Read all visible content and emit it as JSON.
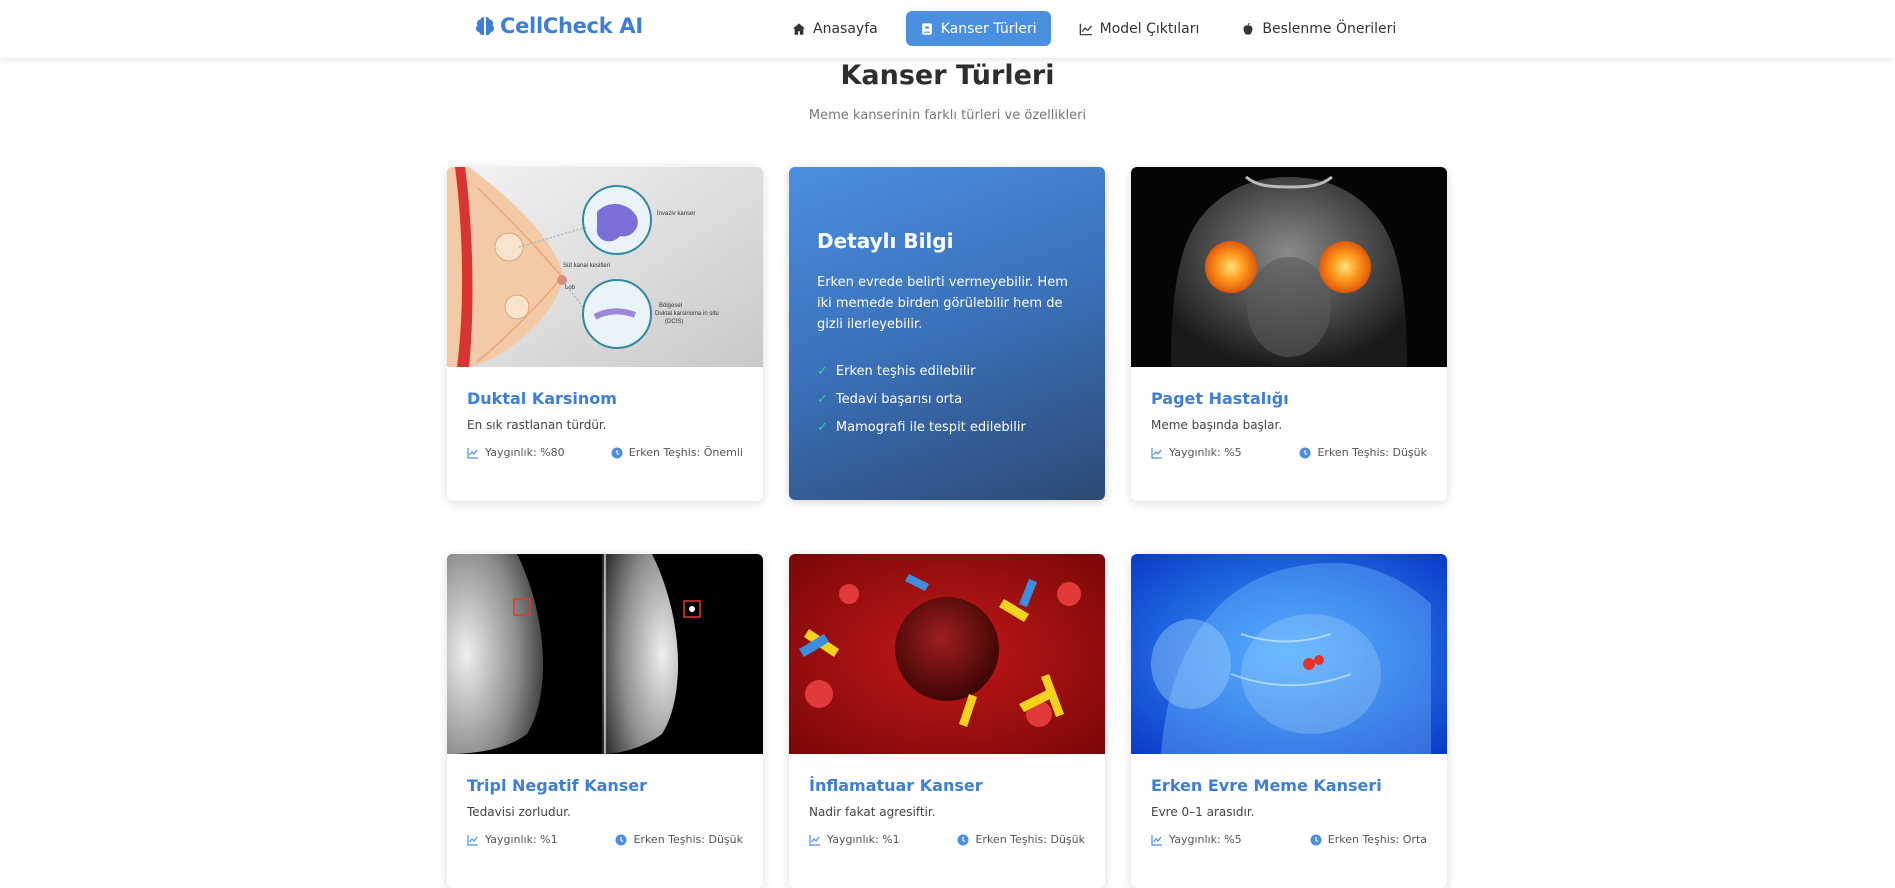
{
  "brand": {
    "name": "CellCheck AI",
    "icon": "brain-icon",
    "color": "#3d7fd6"
  },
  "nav": [
    {
      "label": "Anasayfa",
      "icon": "home-icon",
      "active": false
    },
    {
      "label": "Kanser Türleri",
      "icon": "book-icon",
      "active": true
    },
    {
      "label": "Model Çıktıları",
      "icon": "line-chart-icon",
      "active": false
    },
    {
      "label": "Beslenme Önerileri",
      "icon": "apple-icon",
      "active": false
    }
  ],
  "header": {
    "title": "Kanser Türleri",
    "subtitle": "Meme kanserinin farklı türleri ve özellikleri"
  },
  "cards": [
    {
      "title": "Duktal Karsinom",
      "desc": "En sık rastlanan türdür.",
      "prevalence": "Yaygınlık: %80",
      "early": "Erken Teşhis: Önemli",
      "image": "breast-anatomy-diagram"
    },
    {
      "title": "Paget Hastalığı",
      "desc": "Meme başında başlar.",
      "prevalence": "Yaygınlık: %5",
      "early": "Erken Teşhis: Düşük",
      "image": "xray-torso"
    },
    {
      "title": "Tripl Negatif Kanser",
      "desc": "Tedavisi zorludur.",
      "prevalence": "Yaygınlık: %1",
      "early": "Erken Teşhis: Düşük",
      "image": "mammogram"
    },
    {
      "title": "İnflamatuar Kanser",
      "desc": "Nadir fakat agresiftir.",
      "prevalence": "Yaygınlık: %1",
      "early": "Erken Teşhis: Düşük",
      "image": "cancer-cell-illustration"
    },
    {
      "title": "Erken Evre Meme Kanseri",
      "desc": "Evre 0–1 arasıdır.",
      "prevalence": "Yaygınlık: %5",
      "early": "Erken Teşhis: Orta",
      "image": "blue-anatomy-scan"
    }
  ],
  "info": {
    "title": "Detaylı Bilgi",
    "text": "Erken evrede belirti vermeyebilir. Hem iki memede birden görülebilir hem de gizli ilerleyebilir.",
    "items": [
      "Erken teşhis edilebilir",
      "Tedavi başarısı orta",
      "Mamografi ile tespit edilebilir"
    ]
  },
  "colors": {
    "accent": "#3d7fd6",
    "active_nav": "#4a8fe0",
    "check": "#34d399"
  }
}
